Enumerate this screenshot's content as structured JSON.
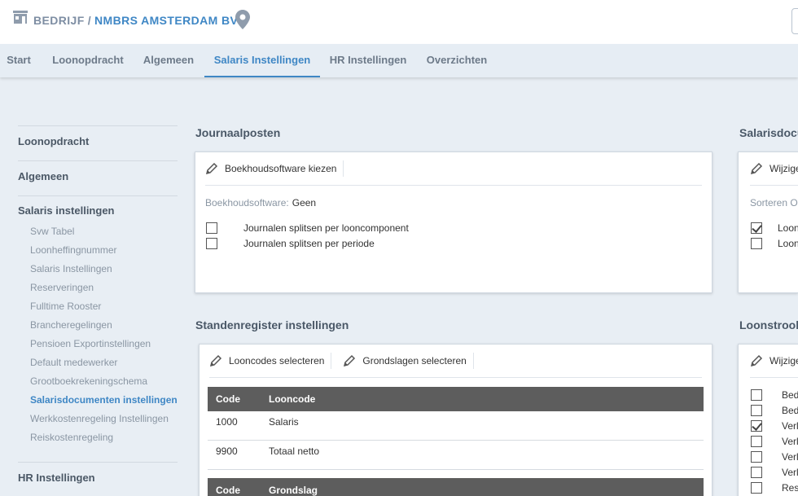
{
  "header": {
    "prefix": "BEDRIJF",
    "separator": "/",
    "company_name": "NMBRS AMSTERDAM BV",
    "icons": [
      "building-icon",
      "location-pin-icon"
    ]
  },
  "nav": {
    "tabs": [
      {
        "label": "Start"
      },
      {
        "label": "Loonopdracht"
      },
      {
        "label": "Algemeen"
      },
      {
        "label": "Salaris Instellingen",
        "active": true
      },
      {
        "label": "HR Instellingen"
      },
      {
        "label": "Overzichten"
      }
    ],
    "active_color": "#3f87c5"
  },
  "sidebar": {
    "sections": [
      {
        "label": "Loonopdracht"
      },
      {
        "label": "Algemeen"
      },
      {
        "label": "Salaris instellingen",
        "items": [
          {
            "label": "Svw Tabel"
          },
          {
            "label": "Loonheffingnummer"
          },
          {
            "label": "Salaris Instellingen"
          },
          {
            "label": "Reserveringen"
          },
          {
            "label": "Fulltime Rooster"
          },
          {
            "label": "Brancheregelingen"
          },
          {
            "label": "Pensioen Exportinstellingen"
          },
          {
            "label": "Default medewerker"
          },
          {
            "label": "Grootboekrekeningschema"
          },
          {
            "label": "Salarisdocumenten instellingen",
            "active": true
          },
          {
            "label": "Werkkostenregeling Instellingen"
          },
          {
            "label": "Reiskostenregeling"
          }
        ]
      },
      {
        "label": "HR Instellingen"
      }
    ]
  },
  "journaalposten": {
    "title": "Journaalposten",
    "button_label": "Boekhoudsoftware kiezen",
    "software_key": "Boekhoudsoftware:",
    "software_value": "Geen",
    "checkboxes": [
      {
        "label": "Journalen splitsen per looncomponent",
        "checked": false
      },
      {
        "label": "Journalen splitsen per periode",
        "checked": false
      }
    ]
  },
  "standenregister": {
    "title": "Standenregister instellingen",
    "buttons": [
      "Looncodes selecteren",
      "Grondslagen selecteren"
    ],
    "looncode_table": {
      "headers": [
        "Code",
        "Looncode"
      ],
      "rows": [
        [
          "1000",
          "Salaris"
        ],
        [
          "9900",
          "Totaal netto"
        ]
      ]
    },
    "grondslag_table": {
      "headers": [
        "Code",
        "Grondslag"
      ]
    }
  },
  "salarisdocumenten": {
    "title": "Salarisdocu",
    "button_label": "Wijzige",
    "sort_label": "Sorteren Op",
    "checkboxes": [
      {
        "label": "Loon",
        "checked": true
      },
      {
        "label": "Loon",
        "checked": false
      }
    ]
  },
  "loonstrook": {
    "title": "Loonstrook",
    "button_label": "Wijzige",
    "checkboxes": [
      {
        "label": "Bed",
        "checked": false
      },
      {
        "label": "Bed",
        "checked": false
      },
      {
        "label": "Verl",
        "checked": true
      },
      {
        "label": "Verl",
        "checked": false
      },
      {
        "label": "Verl",
        "checked": false
      },
      {
        "label": "Verl",
        "checked": false
      },
      {
        "label": "Rese",
        "checked": false
      }
    ]
  },
  "colors": {
    "accent": "#3f87c5",
    "table_header": "#5d5d5d",
    "page_bg": "#e8eef4"
  }
}
